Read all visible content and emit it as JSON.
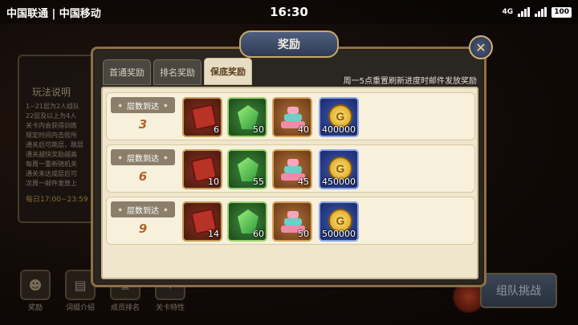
{
  "status_bar": {
    "carriers": "中国联通 | 中国移动",
    "time": "16:30",
    "network": "4G",
    "battery": "100"
  },
  "background": {
    "rules_title": "玩法说明",
    "rules_text": "1~21层为2人组队\n22层及以上为4人\n关卡内会获得训练\n规定时间内击败所\n通关后可跳层，跳层\n通关越快奖励越高\n每周一重新随机关\n通关未达成层后可\n次周一邮件发放上",
    "rules_time": "每日17:00~23:59",
    "bottom_icons": [
      {
        "label": "奖励",
        "icon": "mask-icon"
      },
      {
        "label": "词缀介绍",
        "icon": "book-icon"
      },
      {
        "label": "成员排名",
        "icon": "ranking-icon"
      },
      {
        "label": "关卡特性",
        "icon": "feature-icon"
      }
    ],
    "team_challenge_label": "组队挑战"
  },
  "dialog": {
    "title": "奖励",
    "tabs": [
      {
        "label": "首通奖励",
        "active": false
      },
      {
        "label": "排名奖励",
        "active": false
      },
      {
        "label": "保底奖励",
        "active": true
      }
    ],
    "notice": "周一5点重置刷新进度时邮件发放奖励",
    "rows": [
      {
        "label": "层数到达",
        "floor": "3",
        "items": [
          {
            "type": "scroll-icon",
            "qty": "6"
          },
          {
            "type": "gem-icon",
            "qty": "50"
          },
          {
            "type": "cake-icon",
            "qty": "40"
          },
          {
            "type": "gold-coin-icon",
            "qty": "400000"
          }
        ]
      },
      {
        "label": "层数到达",
        "floor": "6",
        "items": [
          {
            "type": "scroll-icon",
            "qty": "10"
          },
          {
            "type": "gem-icon",
            "qty": "55"
          },
          {
            "type": "cake-icon",
            "qty": "45"
          },
          {
            "type": "gold-coin-icon",
            "qty": "450000"
          }
        ]
      },
      {
        "label": "层数到达",
        "floor": "9",
        "items": [
          {
            "type": "scroll-icon",
            "qty": "14"
          },
          {
            "type": "gem-icon",
            "qty": "60"
          },
          {
            "type": "cake-icon",
            "qty": "50"
          },
          {
            "type": "gold-coin-icon",
            "qty": "500000"
          }
        ]
      }
    ]
  }
}
